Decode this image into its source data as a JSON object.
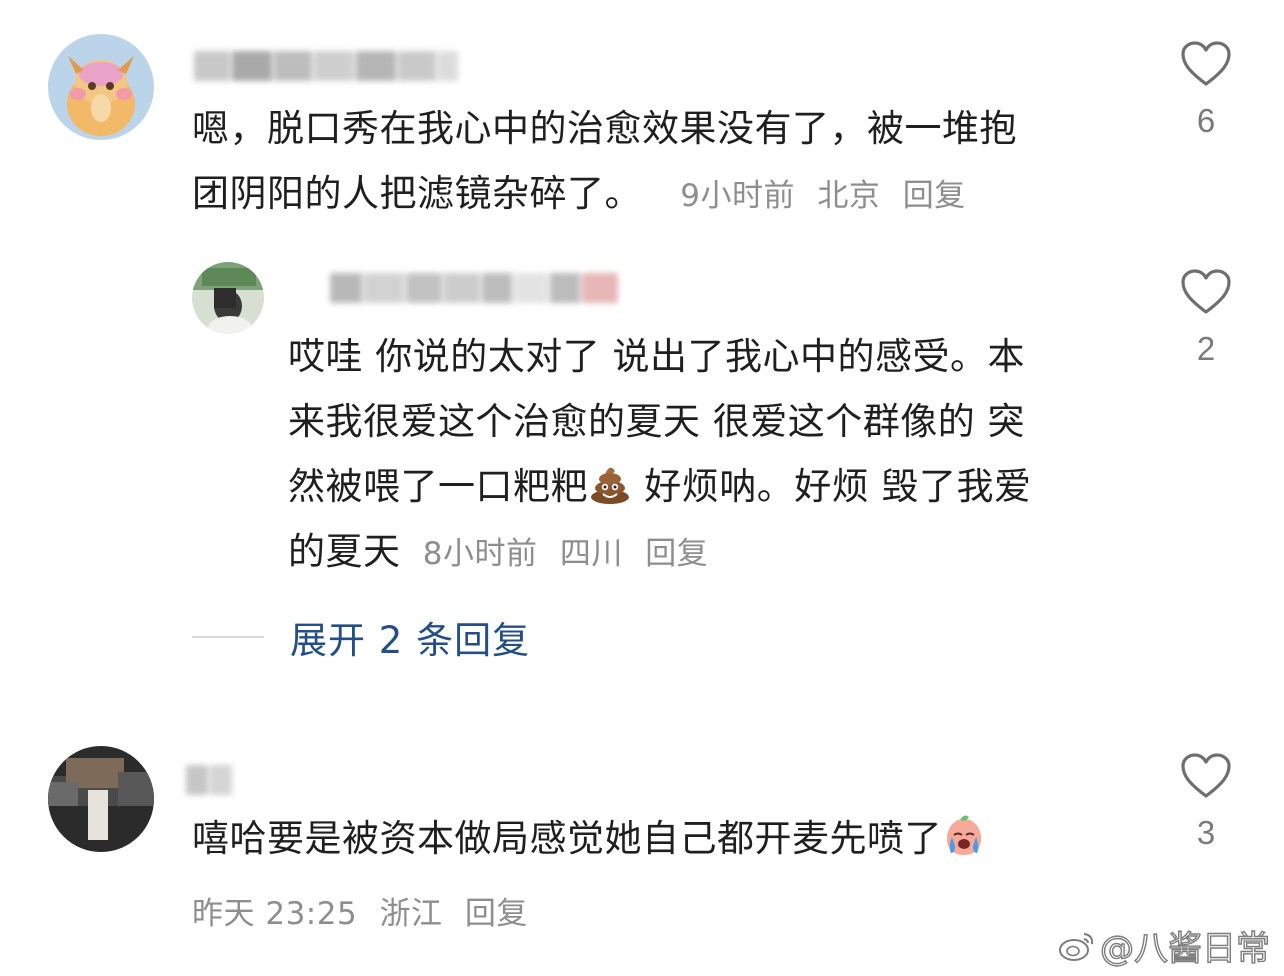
{
  "comments": [
    {
      "text": "嗯，脱口秀在我心中的治愈效果没有了，被一堆抱团阴阳的人把滤镜杂碎了。",
      "line1": "嗯，脱口秀在我心中的治愈效果没有了，被一堆抱",
      "line2": "团阴阳的人把滤镜杂碎了。",
      "time": "9小时前",
      "location": "北京",
      "reply_label": "回复",
      "likes": "6"
    },
    {
      "line1": "哎哇 你说的太对了 说出了我心中的感受。本",
      "line2": "来我很爱这个治愈的夏天 很爱这个群像的 突",
      "line3a": "然被喂了一口粑粑",
      "line3b": " 好烦呐。好烦 毁了我爱",
      "line4": "的夏天",
      "time": "8小时前",
      "location": "四川",
      "reply_label": "回复",
      "likes": "2",
      "emoji_icon": "poop-emoji"
    },
    {
      "text": "嘻哈要是被资本做局感觉她自己都开麦先喷了",
      "emoji_icon": "crying-emoji",
      "time": "昨天 23:25",
      "location": "浙江",
      "reply_label": "回复",
      "likes": "3"
    }
  ],
  "expand_replies_label": "展开 2 条回复",
  "watermark": "@八酱日常",
  "colors": {
    "link": "#234f86",
    "meta": "#8e8e8e",
    "text": "#1f1f1f"
  }
}
